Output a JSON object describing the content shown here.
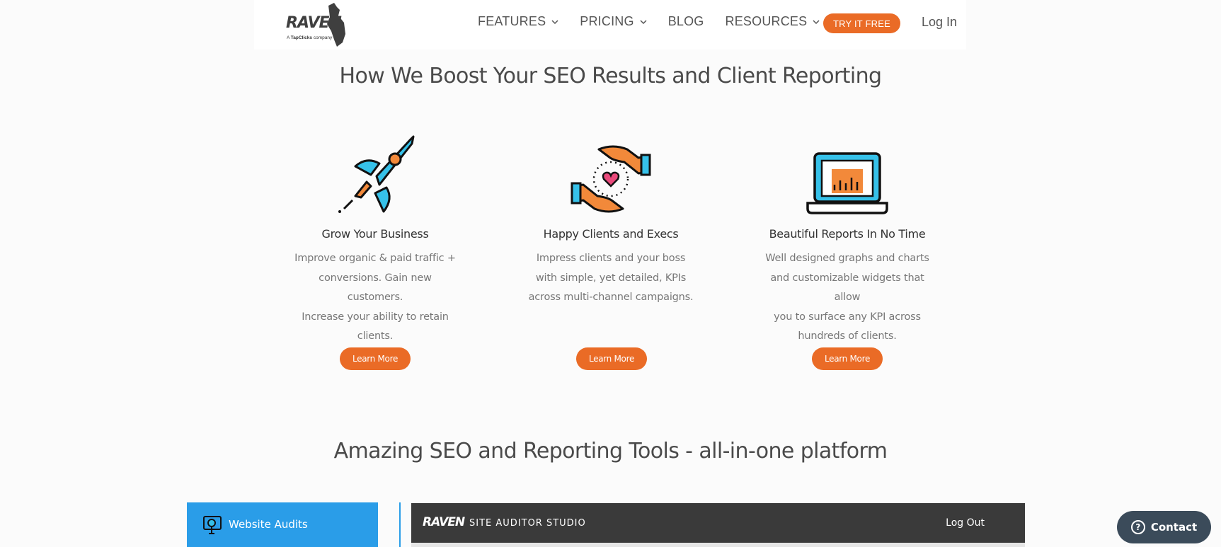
{
  "nav": {
    "logo_text": "RAVEN",
    "logo_sub_prefix": "A ",
    "logo_sub_brand": "TapClicks",
    "logo_sub_suffix": " company",
    "items": [
      {
        "label": "FEATURES",
        "has_dropdown": true
      },
      {
        "label": "PRICING",
        "has_dropdown": true
      },
      {
        "label": "BLOG",
        "has_dropdown": false
      },
      {
        "label": "RESOURCES",
        "has_dropdown": true
      }
    ],
    "cta_label": "TRY IT FREE",
    "login_label": "Log In"
  },
  "section1": {
    "title": "How We Boost Your SEO Results and Client Reporting",
    "features": [
      {
        "icon": "rocket-icon",
        "title": "Grow Your Business",
        "lines": [
          "Improve organic & paid traffic +",
          "conversions. Gain new customers.",
          "Increase your ability to retain",
          "clients."
        ],
        "button": "Learn More"
      },
      {
        "icon": "hands-heart-icon",
        "title": "Happy Clients and Execs",
        "lines": [
          "Impress clients and your boss",
          "with simple, yet detailed, KPIs",
          "across multi-channel campaigns."
        ],
        "button": "Learn More"
      },
      {
        "icon": "laptop-chart-icon",
        "title": "Beautiful Reports In No Time",
        "lines": [
          "Well designed graphs and charts",
          "and customizable widgets that allow",
          "you to surface any KPI across",
          "hundreds of clients."
        ],
        "button": "Learn More"
      }
    ]
  },
  "section2": {
    "title": "Amazing SEO and Reporting Tools - all-in-one platform",
    "tab_label": "Website Audits",
    "studio_logo": "RAVEN",
    "studio_title": "SITE AUDITOR STUDIO",
    "studio_logout": "Log Out"
  },
  "contact_label": "Contact",
  "colors": {
    "accent": "#ea6b26",
    "tab_blue": "#2a9de8",
    "dark_bar": "#3a3a3a",
    "contact_bg": "#3b4b5a"
  }
}
